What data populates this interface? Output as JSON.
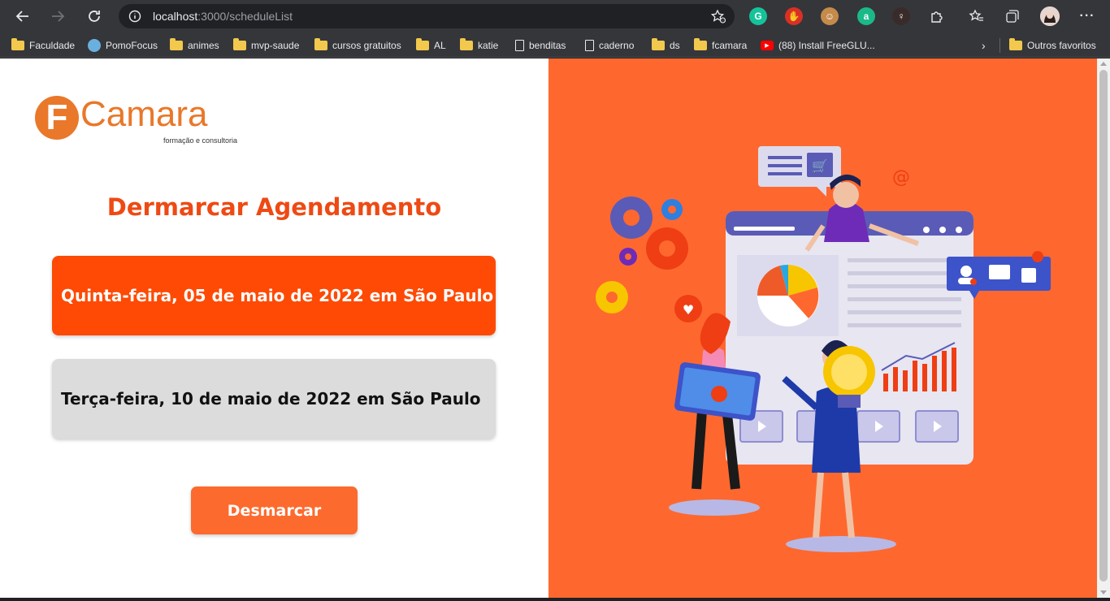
{
  "browser": {
    "url_host": "localhost",
    "url_path": ":3000/scheduleList",
    "bookmarks": [
      {
        "label": "Faculdade",
        "icon": "folder-icon"
      },
      {
        "label": "PomoFocus",
        "icon": "check-circle-icon"
      },
      {
        "label": "animes",
        "icon": "folder-icon"
      },
      {
        "label": "mvp-saude",
        "icon": "folder-icon"
      },
      {
        "label": "cursos gratuitos",
        "icon": "folder-icon"
      },
      {
        "label": "AL",
        "icon": "folder-icon"
      },
      {
        "label": "katie",
        "icon": "folder-icon"
      },
      {
        "label": "benditas",
        "icon": "page-icon"
      },
      {
        "label": "caderno",
        "icon": "page-icon"
      },
      {
        "label": "ds",
        "icon": "folder-icon"
      },
      {
        "label": "fcamara",
        "icon": "folder-icon"
      },
      {
        "label": "(88) Install FreeGLU...",
        "icon": "youtube-icon"
      }
    ],
    "other_favorites": "Outros favoritos"
  },
  "logo": {
    "letter": "F",
    "word": "Camara",
    "tagline": "formação e consultoria"
  },
  "page": {
    "title": "Dermarcar Agendamento",
    "schedules": [
      {
        "label": "Quinta-feira, 05 de maio de 2022 em São Paulo",
        "selected": true
      },
      {
        "label": "Terça-feira, 10 de maio de 2022 em São Paulo",
        "selected": false
      }
    ],
    "button_label": "Desmarcar"
  },
  "colors": {
    "accent": "#fe4a04",
    "title": "#ee4a14",
    "button": "#fd6a2e",
    "panel": "#fe682f",
    "logo": "#e9782a"
  }
}
